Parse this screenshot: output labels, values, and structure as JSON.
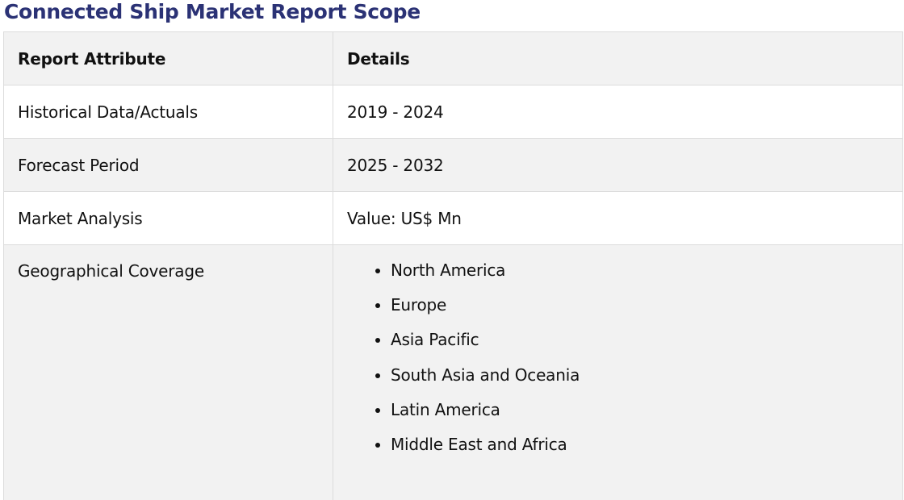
{
  "title": "Connected Ship Market Report Scope",
  "table": {
    "headers": [
      "Report Attribute",
      "Details"
    ],
    "rows": [
      {
        "attribute": "Historical Data/Actuals",
        "details": "2019 - 2024"
      },
      {
        "attribute": "Forecast Period",
        "details": "2025 - 2032"
      },
      {
        "attribute": "Market Analysis",
        "details": "Value: US$ Mn"
      },
      {
        "attribute": "Geographical Coverage",
        "regions": [
          "North America",
          "Europe",
          "Asia Pacific",
          "South Asia and Oceania",
          "Latin America",
          "Middle East and Africa"
        ]
      }
    ]
  }
}
